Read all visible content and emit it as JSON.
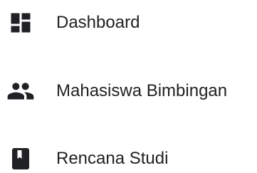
{
  "nav": {
    "items": [
      {
        "label": "Dashboard",
        "icon": "dashboard-icon"
      },
      {
        "label": "Mahasiswa Bimbingan",
        "icon": "people-icon"
      },
      {
        "label": "Rencana Studi",
        "icon": "book-icon"
      }
    ]
  },
  "colors": {
    "icon": "#202124",
    "text": "#202124",
    "background": "#ffffff"
  }
}
